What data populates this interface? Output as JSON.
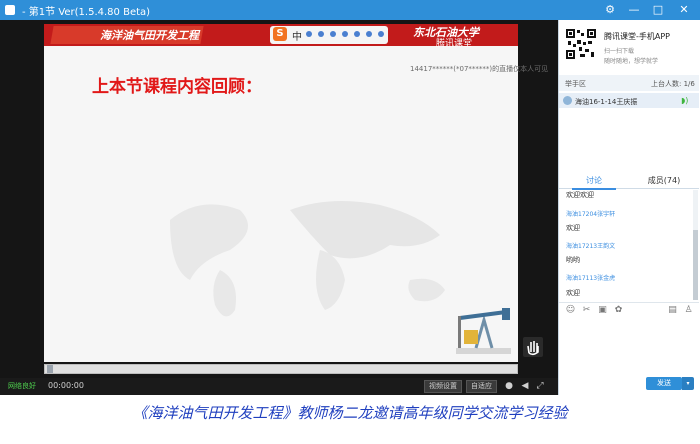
{
  "window": {
    "title": "- 第1节 Ver(1.5.4.80 Beta)",
    "controls": {
      "settings": "⚙",
      "minimize": "—",
      "maximize": "□",
      "close": "✕"
    }
  },
  "video": {
    "slide": {
      "course_title": "海洋油气田开发工程",
      "university": "东北石油大学",
      "tencent_sub": "腾讯课堂",
      "ime_label": "中",
      "ime_logo": "S",
      "watermark": "14417******(*07******)的直播仅本人可见",
      "heading": "上本节课程内容回顾："
    },
    "controls": {
      "network_status": "网络良好",
      "time": "00:00:00",
      "video_settings": "视频设置",
      "auto_fit": "自适应"
    }
  },
  "panel": {
    "app_name": "腾讯课堂-手机APP",
    "app_sub1": "扫一扫下载",
    "app_sub2": "随时随地，想学就学",
    "hand_raise": {
      "title": "举手区",
      "count_label": "上台人数: 1/6"
    },
    "student": {
      "name": "海油16-1-14王庆振"
    },
    "tabs": {
      "discuss": "讨论",
      "members": "成员(74)"
    },
    "chat": [
      {
        "text": "欢迎欢迎",
        "kind": "msg"
      },
      {
        "text": "海油17204张宇轩",
        "kind": "name"
      },
      {
        "text": "欢迎",
        "kind": "msg"
      },
      {
        "text": "海油17213王韵文",
        "kind": "name"
      },
      {
        "text": "哟哟",
        "kind": "msg"
      },
      {
        "text": "海油17113张金虎",
        "kind": "name"
      },
      {
        "text": "欢迎",
        "kind": "msg"
      }
    ],
    "send_label": "发送",
    "send_dropdown": "▾"
  },
  "caption": "《海洋油气田开发工程》教师杨二龙邀请高年级同学交流学习经验",
  "colors": {
    "titlebar": "#2f8fd8",
    "slide_header": "#c21b1b",
    "heading_red": "#e11818",
    "caption_blue": "#1f3fbf",
    "link_blue": "#3a8de0"
  }
}
